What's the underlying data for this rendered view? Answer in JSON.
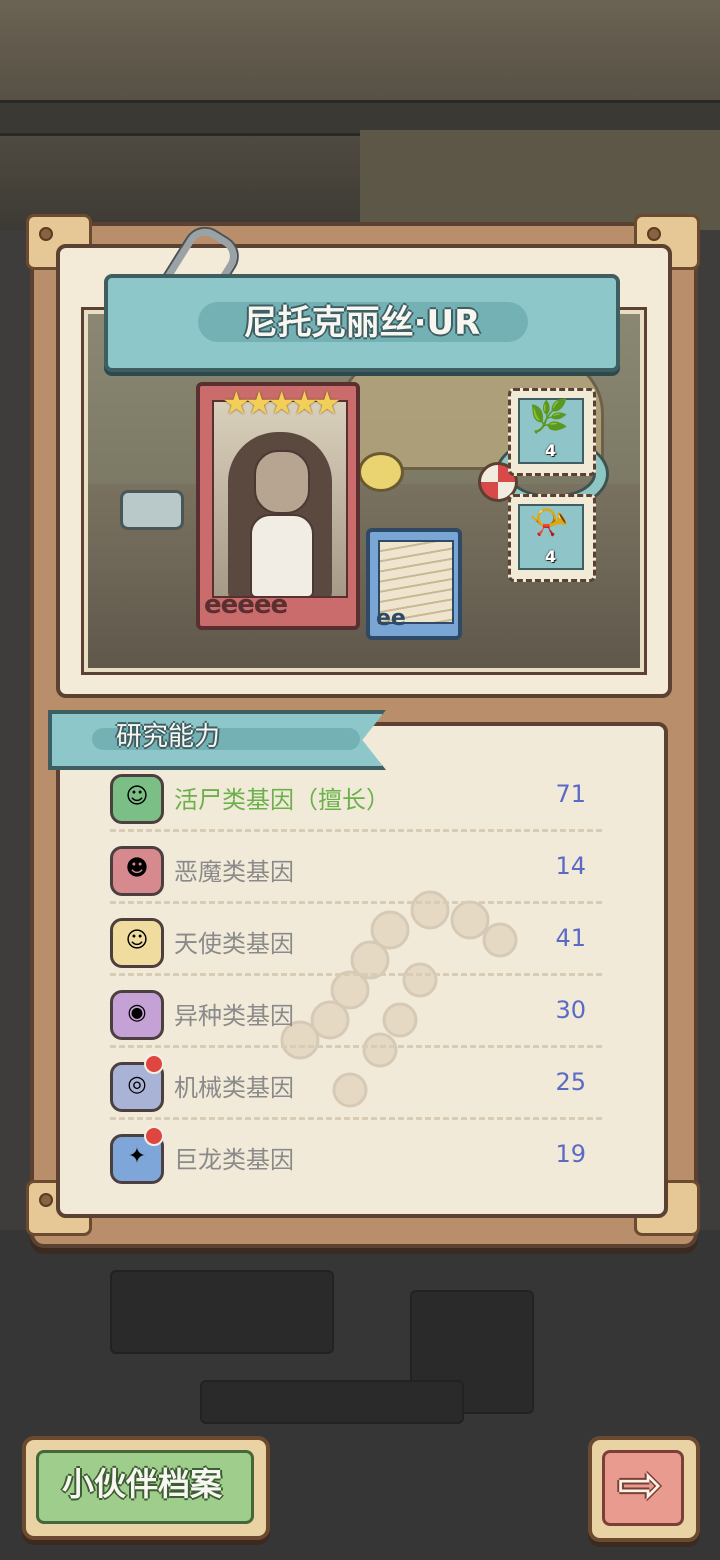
{
  "character": {
    "name_title": "尼托克丽丝·UR",
    "card_rank_text": "eeeee",
    "companion_rank_text": "ee",
    "star_glyphs": "★★★★★"
  },
  "items": [
    {
      "icon": "slime-plant-icon",
      "glyph": "🌿",
      "count": "4"
    },
    {
      "icon": "horn-icon",
      "glyph": "📯",
      "count": "4"
    }
  ],
  "research": {
    "title": "研究能力",
    "genes": [
      {
        "icon": "zombie-gene-icon",
        "name": "活尸类基因（擅长）",
        "value": "71",
        "special": true,
        "icon_bg": "#7bbf86",
        "glyph": "☺"
      },
      {
        "icon": "demon-gene-icon",
        "name": "恶魔类基因",
        "value": "14",
        "special": false,
        "icon_bg": "#d68a8e",
        "glyph": "☻"
      },
      {
        "icon": "angel-gene-icon",
        "name": "天使类基因",
        "value": "41",
        "special": false,
        "icon_bg": "#f1dca0",
        "glyph": "☺"
      },
      {
        "icon": "alien-gene-icon",
        "name": "异种类基因",
        "value": "30",
        "special": false,
        "icon_bg": "#c5a2d6",
        "glyph": "◉"
      },
      {
        "icon": "mech-gene-icon",
        "name": "机械类基因",
        "value": "25",
        "special": false,
        "icon_bg": "#a9b3d6",
        "glyph": "◎"
      },
      {
        "icon": "dragon-gene-icon",
        "name": "巨龙类基因",
        "value": "19",
        "special": false,
        "icon_bg": "#7fa6d8",
        "glyph": "✦"
      }
    ]
  },
  "buttons": {
    "profile_label": "小伙伴档案",
    "next_arrow": "⇨"
  },
  "colors": {
    "accent_teal": "#8ec7c9",
    "frame_brown": "#5a4132",
    "value_blue": "#5b6bc5",
    "specialty_green": "#6bb14a"
  }
}
